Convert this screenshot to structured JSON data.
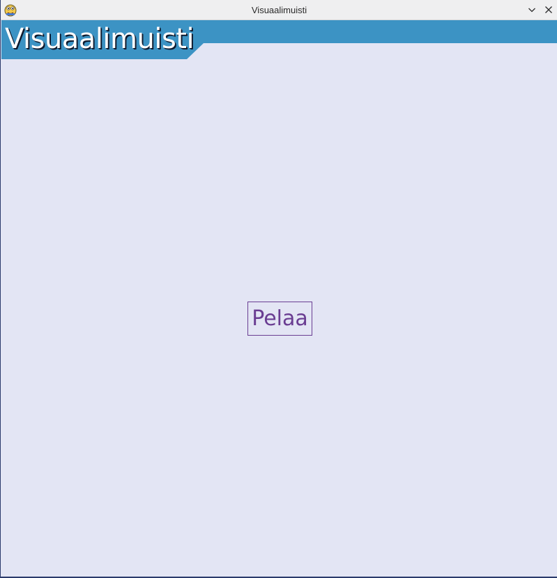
{
  "window": {
    "title": "Visuaalimuisti",
    "app_icon": "python-snake-icon",
    "controls": {
      "minimize_icon": "chevron-down-icon",
      "close_icon": "close-icon"
    }
  },
  "header": {
    "title": "Visuaalimuisti",
    "band_color": "#3c93c4"
  },
  "main": {
    "play_button_label": "Pelaa",
    "background_color": "#e3e5f4",
    "accent_color": "#6a3d92"
  }
}
